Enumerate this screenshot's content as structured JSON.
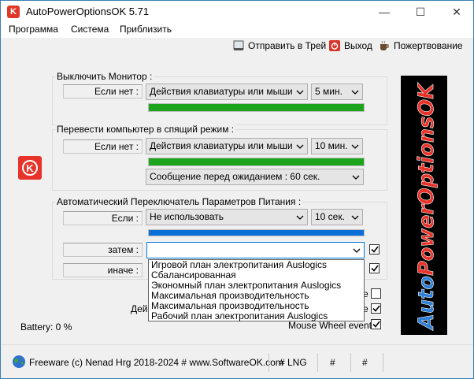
{
  "window": {
    "title": "AutoPowerOptionsOK 5.71",
    "app_icon_glyph": "K",
    "minimize": "—",
    "maximize": "☐",
    "close": "✕"
  },
  "menu": [
    "Программа",
    "Система",
    "Приблизить"
  ],
  "toolbar": {
    "tray_label": "Отправить в Трей",
    "exit_label": "Выход",
    "donate_label": "Пожертвование"
  },
  "monitor_group": {
    "title": "Выключить Монитор :",
    "condition_label": "Если нет :",
    "action_value": "Действия клавиатуры или мыши",
    "time_value": "5 мин.",
    "progress": 1.0
  },
  "sleep_group": {
    "title": "Перевести компьютер в спящий режим :",
    "condition_label": "Если нет :",
    "action_value": "Действия клавиатуры или мыши",
    "time_value": "10 мин.",
    "progress": 1.0,
    "message_value": "Сообщение перед ожиданием : 60 сек."
  },
  "switch_group": {
    "title": "Автоматический Переключатель Параметров Питания :",
    "if_label": "Если :",
    "if_value": "Не использовать",
    "time_value": "10 сек.",
    "progress": 1.0,
    "then_label": "затем :",
    "then_value": "",
    "else_label": "иначе :",
    "dropdown_options": [
      "Игровой план электропитания Auslogics",
      "Сбалансированная",
      "Экономный план электропитания Auslogics",
      "Максимальная производительность",
      "Максимальная производительность",
      "Рабочий план электропитания Auslogics"
    ],
    "then_checked": true,
    "else_checked": true
  },
  "options": {
    "partial_label": "Дей",
    "row1_partial": "e",
    "row2_partial": "e",
    "row1_checked": false,
    "row2_checked": true,
    "mouse_wheel_label": "Mouse Wheel events",
    "mouse_wheel_checked": true
  },
  "battery_label": "Battery: 0 %",
  "banner_text": "AutoPowerOptionsOK",
  "logo_glyph": "K",
  "statusbar": {
    "freeware": "Freeware (c) Nenad Hrg 2018-2024 # www.SoftwareOK.com",
    "lng": "# LNG",
    "hash1": "#",
    "hash2": "#"
  },
  "colors": {
    "progress_green": "#1ca51c",
    "progress_blue": "#0a6fd6",
    "accent_red": "#e8332a",
    "banner_red": "#e8332a",
    "banner_blue": "#2f7fd6"
  }
}
